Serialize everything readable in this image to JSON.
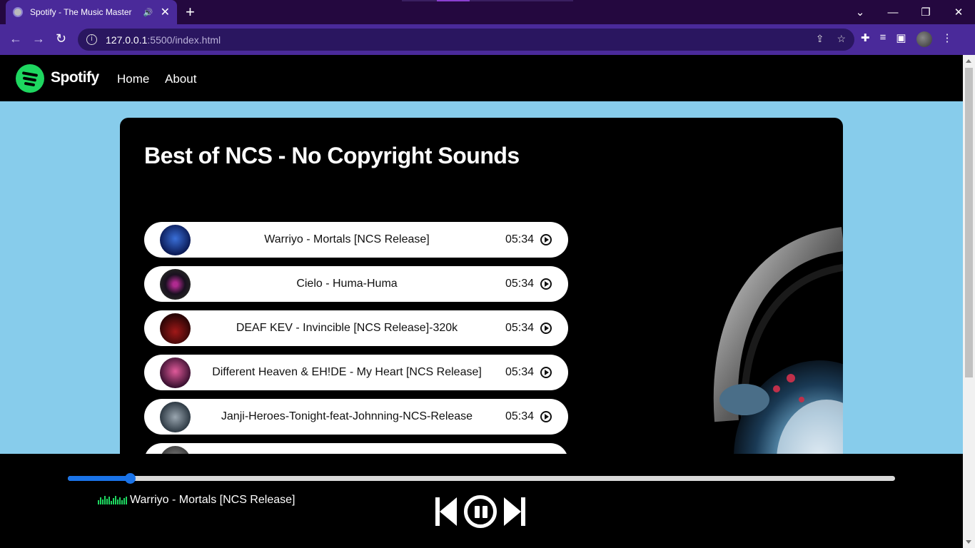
{
  "browser": {
    "tab_title": "Spotify - The Music Master",
    "url_host": "127.0.0.1",
    "url_path": ":5500/index.html"
  },
  "site": {
    "brand": "Spotify",
    "nav": [
      "Home",
      "About"
    ]
  },
  "playlist": {
    "title": "Best of NCS - No Copyright Sounds",
    "songs": [
      {
        "name": "Warriyo - Mortals [NCS Release]",
        "duration": "05:34"
      },
      {
        "name": "Cielo - Huma-Huma",
        "duration": "05:34"
      },
      {
        "name": "DEAF KEV - Invincible [NCS Release]-320k",
        "duration": "05:34"
      },
      {
        "name": "Different Heaven & EH!DE - My Heart [NCS Release]",
        "duration": "05:34"
      },
      {
        "name": "Janji-Heroes-Tonight-feat-Johnning-NCS-Release",
        "duration": "05:34"
      }
    ]
  },
  "player": {
    "now_playing": "Warriyo - Mortals [NCS Release]",
    "progress": 0.075
  },
  "colors": {
    "page_bg": "#87cceb",
    "accent": "#1ed760",
    "progress": "#1a73e8"
  }
}
